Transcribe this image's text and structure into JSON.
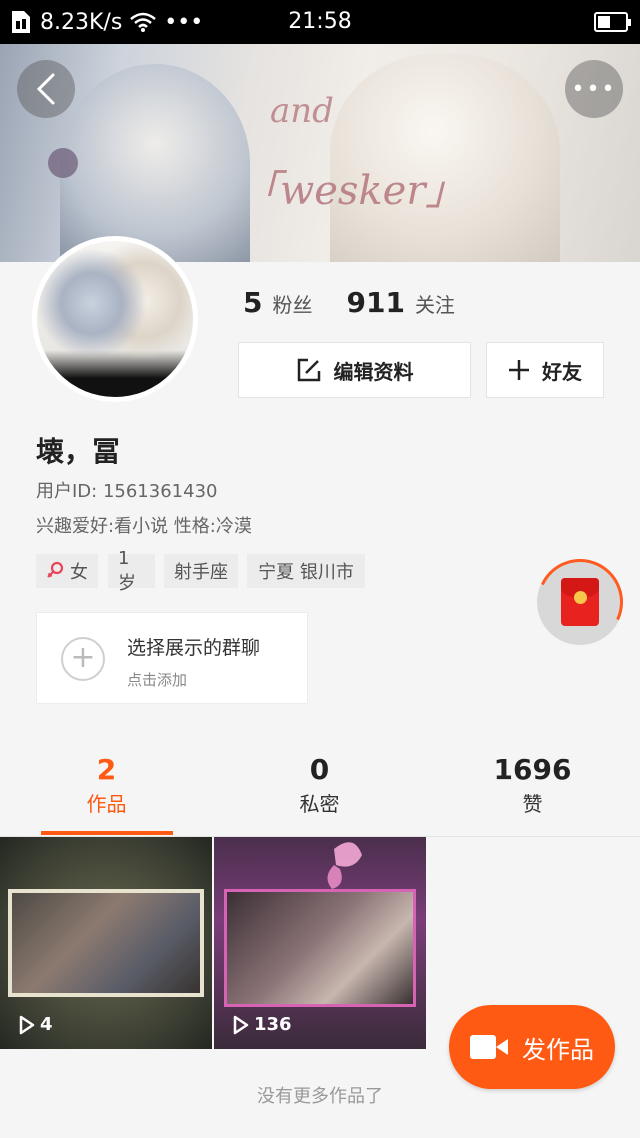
{
  "status_bar": {
    "network_speed": "8.23K/s",
    "more": "•••",
    "time": "21:58",
    "battery_level": 0.45
  },
  "header": {
    "back_icon": "chevron-left-icon",
    "more_icon": "more-dots-icon",
    "more_label": "•••"
  },
  "profile": {
    "fans_count": "5",
    "fans_label": "粉丝",
    "following_count": "911",
    "following_label": "关注",
    "edit_button": "编辑资料",
    "friend_button": "好友",
    "name": "壊，冨",
    "user_id": "用户ID: 1561361430",
    "description": "兴趣爱好:看小说  性格:冷漠",
    "tags": {
      "gender": "女",
      "age": "1岁",
      "zodiac": "射手座",
      "location": "宁夏 银川市"
    }
  },
  "group_card": {
    "title": "选择展示的群聊",
    "subtitle": "点击添加",
    "plus": "+"
  },
  "tabs": {
    "works": {
      "count": "2",
      "label": "作品"
    },
    "private": {
      "count": "0",
      "label": "私密"
    },
    "likes": {
      "count": "1696",
      "label": "赞"
    }
  },
  "videos": [
    {
      "plays": "4"
    },
    {
      "plays": "136"
    }
  ],
  "publish_button": "发作品",
  "footer_text": "没有更多作品了",
  "colors": {
    "accent": "#fe5a13",
    "red_packet": "#e8231f",
    "gender_icon": "#e8455a"
  }
}
